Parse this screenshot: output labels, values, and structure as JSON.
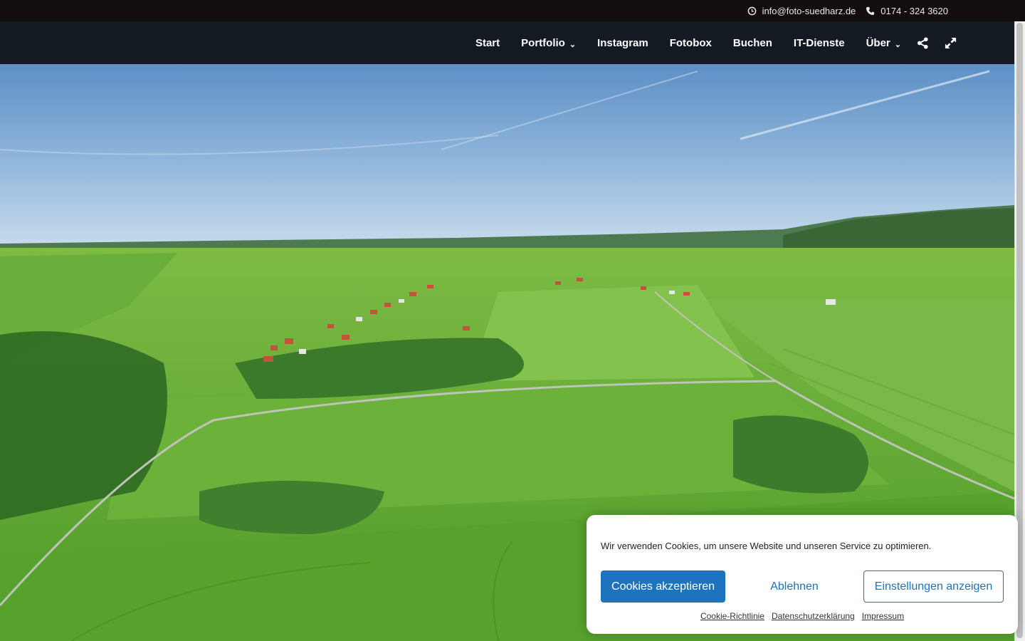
{
  "topbar": {
    "email": "info@foto-suedharz.de",
    "phone": "0174 - 324 3620",
    "email_icon": "clock-icon",
    "phone_icon": "phone-icon"
  },
  "nav": {
    "items": [
      {
        "label": "Start"
      },
      {
        "label": "Portfolio",
        "dropdown": true
      },
      {
        "label": "Instagram"
      },
      {
        "label": "Fotobox"
      },
      {
        "label": "Buchen"
      },
      {
        "label": "IT-Dienste"
      },
      {
        "label": "Über",
        "dropdown": true
      }
    ],
    "chevron": "⌄",
    "icons": [
      "share-icon",
      "fullscreen-icon"
    ]
  },
  "hero": {
    "image": "aerial landscape photo"
  },
  "cookie": {
    "message": "Wir verwenden Cookies, um unsere Website und unseren Service zu optimieren.",
    "accept_label": "Cookies akzeptieren",
    "deny_label": "Ablehnen",
    "prefs_label": "Einstellungen anzeigen",
    "links": {
      "policy": "Cookie-Richtlinie",
      "privacy": "Datenschutzerklärung",
      "imprint": "Impressum"
    }
  },
  "colors": {
    "accent": "#1e73be",
    "topbar_bg": "#130d0d",
    "navbar_bg": "#141a22"
  }
}
